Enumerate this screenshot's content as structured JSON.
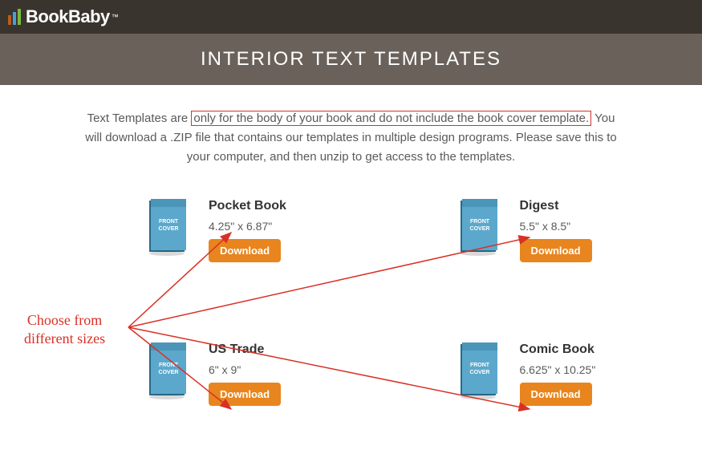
{
  "header": {
    "brand": "BookBaby"
  },
  "banner": {
    "title": "INTERIOR TEXT TEMPLATES"
  },
  "intro": {
    "pre": "Text Templates are ",
    "highlighted": "only for the body of your book and do not include the book cover template.",
    "post": " You will download a .ZIP file that contains our templates in multiple design programs. Please save this to your computer, and then unzip to get access to the templates."
  },
  "templates": [
    {
      "title": "Pocket Book",
      "dimensions": "4.25\" x 6.87\"",
      "button": "Download"
    },
    {
      "title": "Digest",
      "dimensions": "5.5\" x 8.5\"",
      "button": "Download"
    },
    {
      "title": "US Trade",
      "dimensions": "6\" x 9\"",
      "button": "Download"
    },
    {
      "title": "Comic Book",
      "dimensions": "6.625\" x 10.25\"",
      "button": "Download"
    }
  ],
  "annotation": {
    "line1": "Choose from",
    "line2": "different sizes"
  },
  "book_label": "FRONT COVER",
  "colors": {
    "topbar": "#3a342e",
    "banner": "#6a625a",
    "button": "#e8851e",
    "annotation": "#d93025"
  }
}
